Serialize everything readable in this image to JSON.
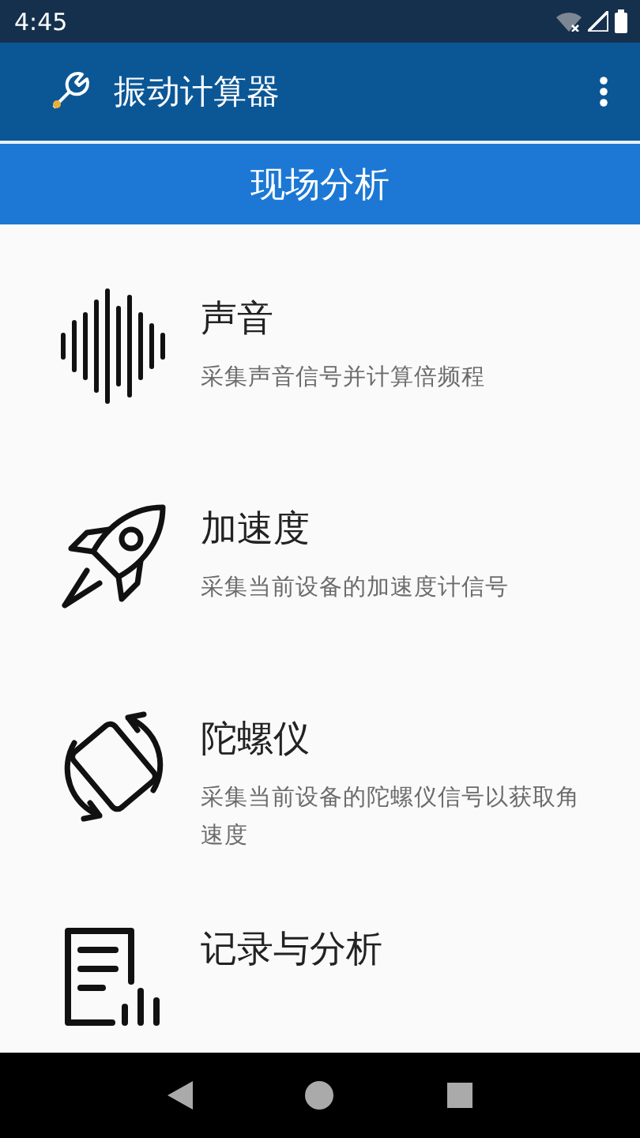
{
  "status_bar": {
    "time": "4:45"
  },
  "app_bar": {
    "title": "振动计算器"
  },
  "section": {
    "title": "现场分析"
  },
  "items": [
    {
      "kind": "sound",
      "title": "声音",
      "description": "采集声音信号并计算倍频程"
    },
    {
      "kind": "rocket",
      "title": "加速度",
      "description": "采集当前设备的加速度计信号"
    },
    {
      "kind": "gyro",
      "title": "陀螺仪",
      "description": "采集当前设备的陀螺仪信号以获取角速度"
    },
    {
      "kind": "record",
      "title": "记录与分析"
    }
  ]
}
